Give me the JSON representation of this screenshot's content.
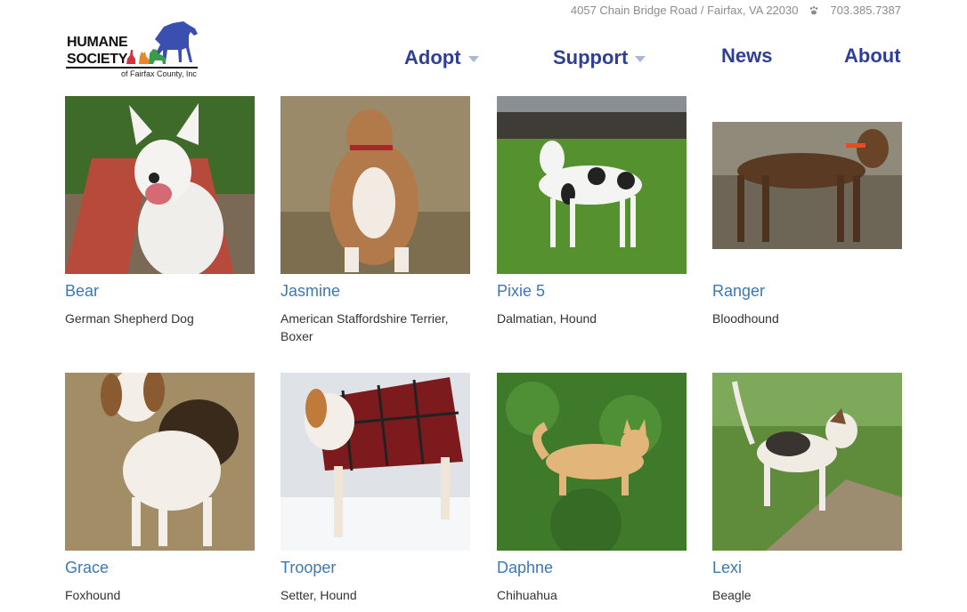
{
  "header": {
    "address": "4057 Chain Bridge Road / Fairfax, VA 22030",
    "phone": "703.385.7387",
    "logo": {
      "line1": "HUMANE",
      "line2": "SOCIETY",
      "line3": "of Fairfax County, Inc"
    }
  },
  "nav": {
    "items": [
      {
        "label": "Adopt"
      },
      {
        "label": "Support"
      },
      {
        "label": "News"
      },
      {
        "label": "About"
      }
    ]
  },
  "colors": {
    "nav": "#2e3f96",
    "link": "#3b79b5",
    "text": "#333333"
  },
  "pets": [
    {
      "name": "Bear",
      "breed": "German Shepherd Dog"
    },
    {
      "name": "Jasmine",
      "breed": "American Staffordshire Terrier, Boxer"
    },
    {
      "name": "Pixie 5",
      "breed": "Dalmatian, Hound"
    },
    {
      "name": "Ranger",
      "breed": "Bloodhound"
    },
    {
      "name": "Grace",
      "breed": "Foxhound"
    },
    {
      "name": "Trooper",
      "breed": "Setter, Hound"
    },
    {
      "name": "Daphne",
      "breed": "Chihuahua"
    },
    {
      "name": "Lexi",
      "breed": "Beagle"
    }
  ]
}
